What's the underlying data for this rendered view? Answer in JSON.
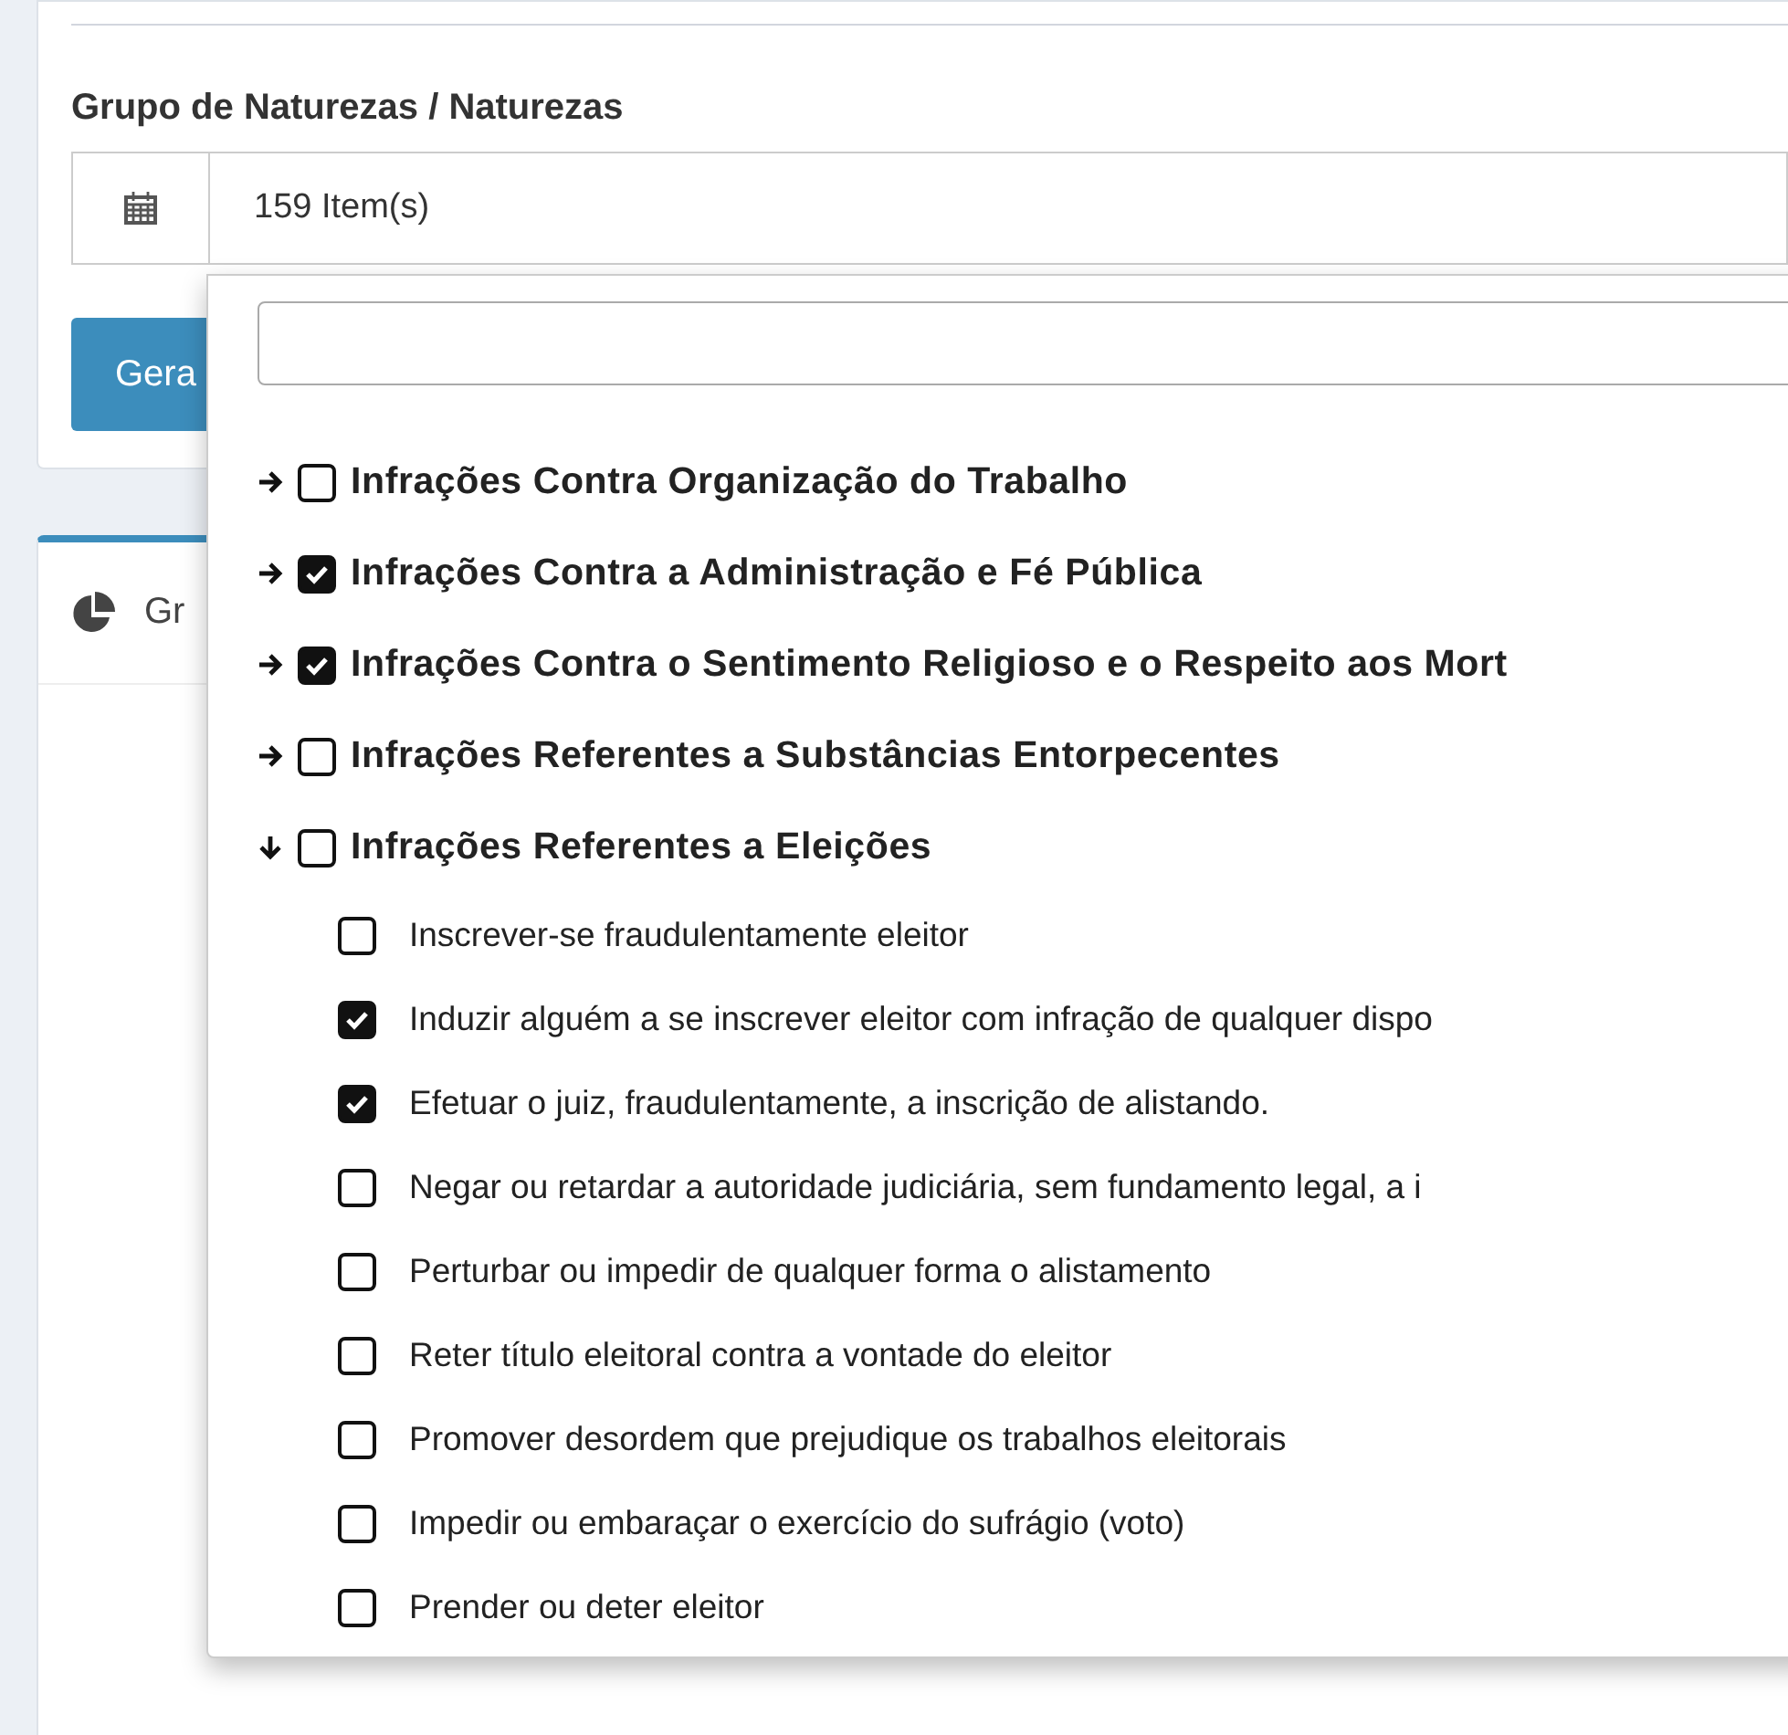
{
  "form": {
    "label": "Grupo de Naturezas / Naturezas",
    "select_value": "159 Item(s)",
    "button": "Gera"
  },
  "chart_panel": {
    "title": "Gr"
  },
  "dropdown": {
    "groups": [
      {
        "label": "Infrações Contra Organização do Trabalho",
        "checked": false,
        "expanded": false
      },
      {
        "label": "Infrações Contra a Administração e Fé Pública",
        "checked": true,
        "expanded": false
      },
      {
        "label": "Infrações Contra o Sentimento Religioso e o Respeito aos Mort",
        "checked": true,
        "expanded": false
      },
      {
        "label": "Infrações Referentes a Substâncias Entorpecentes",
        "checked": false,
        "expanded": false
      },
      {
        "label": "Infrações Referentes a Eleições",
        "checked": false,
        "expanded": true,
        "children": [
          {
            "label": "Inscrever-se fraudulentamente eleitor",
            "checked": false
          },
          {
            "label": "Induzir alguém a se inscrever eleitor com infração de qualquer dispo",
            "checked": true
          },
          {
            "label": "Efetuar o juiz, fraudulentamente, a inscrição de alistando.",
            "checked": true
          },
          {
            "label": "Negar ou retardar a autoridade judiciária, sem fundamento legal, a i",
            "checked": false
          },
          {
            "label": "Perturbar ou impedir de qualquer forma o alistamento",
            "checked": false
          },
          {
            "label": "Reter título eleitoral contra a vontade do eleitor",
            "checked": false
          },
          {
            "label": "Promover desordem que prejudique os trabalhos eleitorais",
            "checked": false
          },
          {
            "label": "Impedir ou embaraçar o exercício do sufrágio (voto)",
            "checked": false
          },
          {
            "label": "Prender ou deter eleitor",
            "checked": false
          }
        ]
      }
    ]
  }
}
